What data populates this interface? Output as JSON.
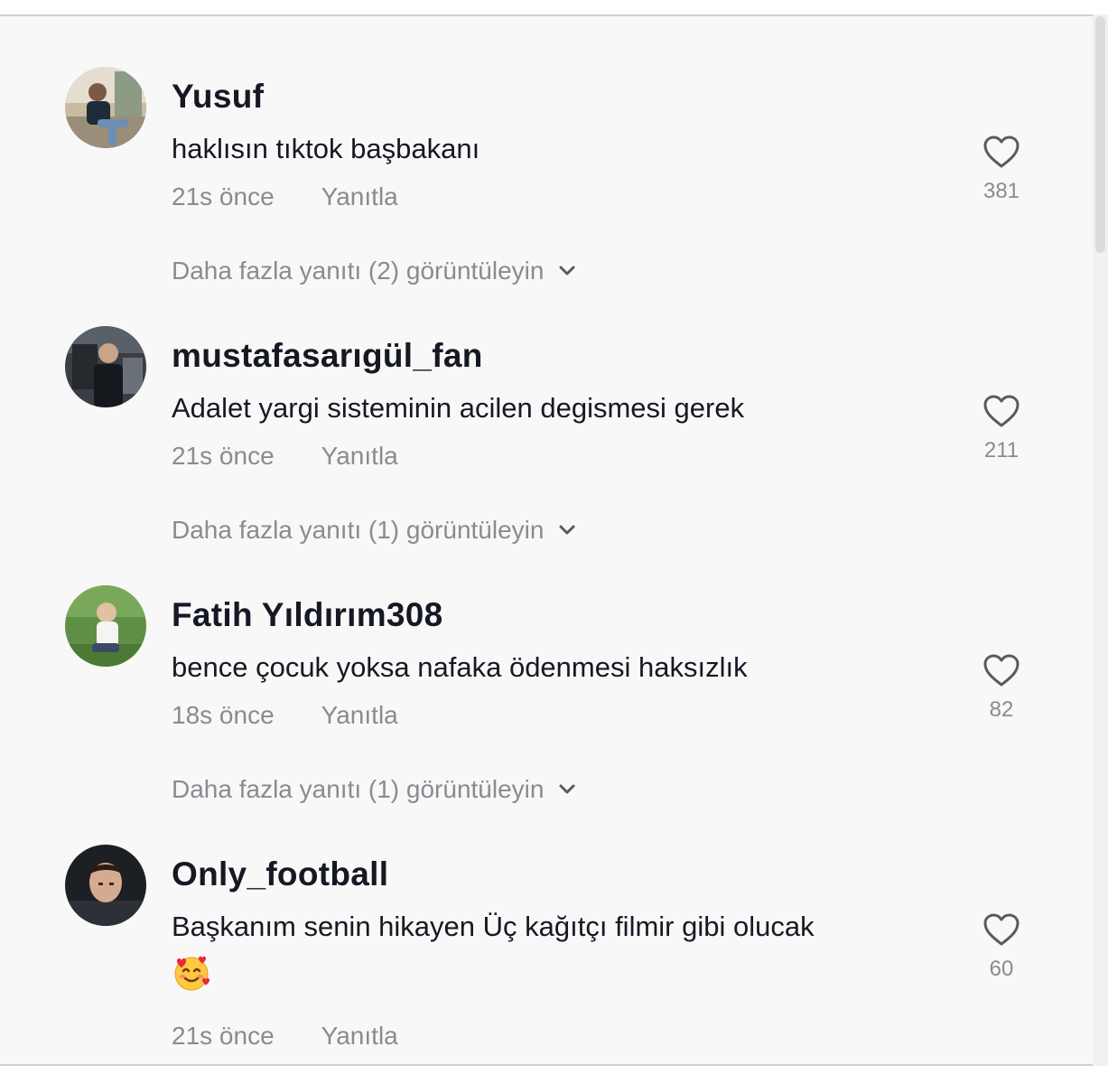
{
  "comments": [
    {
      "username": "Yusuf",
      "text": "haklısın tıktok başbakanı",
      "time": "21s önce",
      "reply": "Yanıtla",
      "likes": "381",
      "more_replies": "Daha fazla yanıtı (2) görüntüleyin"
    },
    {
      "username": "mustafasarıgül_fan",
      "text": "Adalet yargi sisteminin acilen degismesi gerek",
      "time": "21s önce",
      "reply": "Yanıtla",
      "likes": "211",
      "more_replies": "Daha fazla yanıtı (1) görüntüleyin"
    },
    {
      "username": "Fatih Yıldırım308",
      "text": "bence çocuk yoksa nafaka ödenmesi haksızlık",
      "time": "18s önce",
      "reply": "Yanıtla",
      "likes": "82",
      "more_replies": "Daha fazla yanıtı (1) görüntüleyin"
    },
    {
      "username": "Only_football",
      "text": "Başkanım senin hikayen Üç kağıtçı filmir gibi olucak",
      "time": "21s önce",
      "reply": "Yanıtla",
      "likes": "60",
      "emoji": "smiling-face-with-hearts"
    }
  ],
  "icons": {
    "like": "heart-outline-icon",
    "expand": "chevron-down-icon"
  },
  "colors": {
    "text": "#161823",
    "secondary": "#8a8b91",
    "background": "#f8f8f8"
  }
}
